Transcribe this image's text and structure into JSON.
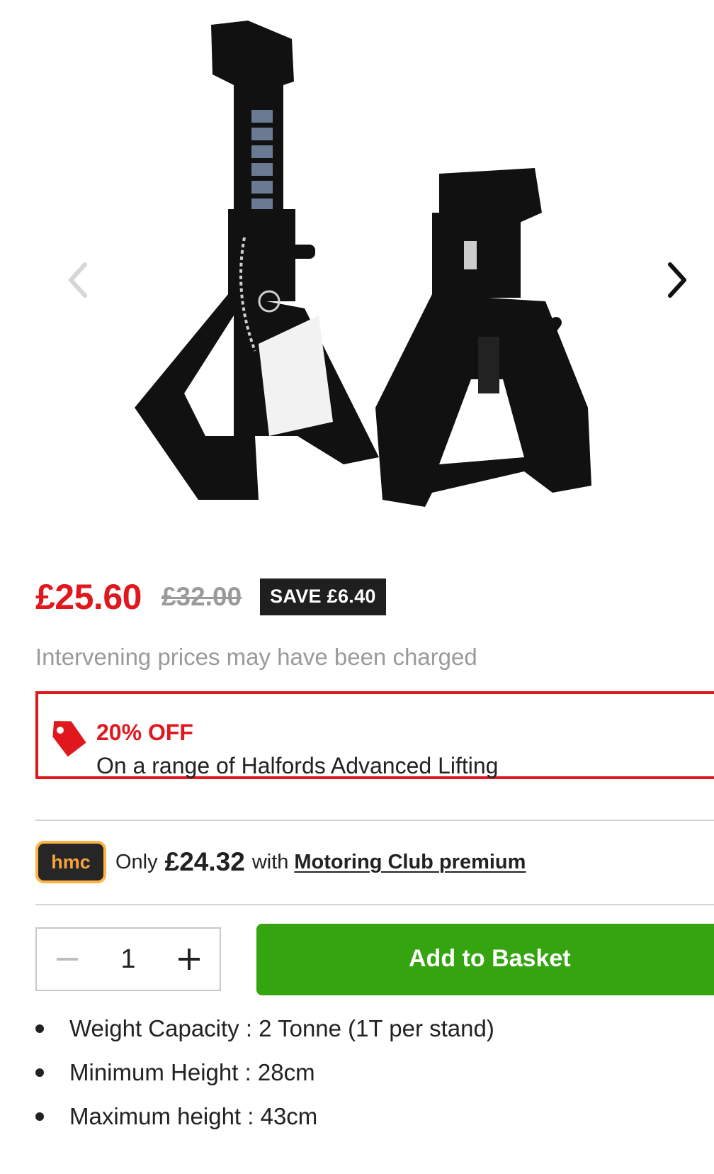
{
  "gallery": {
    "image_alt": "Pair of black axle stands",
    "prev_icon": "chevron-left-icon",
    "next_icon": "chevron-right-icon"
  },
  "price": {
    "current": "£25.60",
    "was": "£32.00",
    "save_badge": "SAVE £6.40",
    "note": "Intervening prices may have been charged"
  },
  "offer": {
    "icon": "price-tag-icon",
    "title": "20% OFF",
    "text": "On a range of Halfords Advanced Lifting"
  },
  "hmc": {
    "badge": "hmc",
    "only": "Only",
    "price": "£24.32",
    "with": "with",
    "link": "Motoring Club premium"
  },
  "quantity": {
    "value": "1",
    "decrease_icon": "minus-icon",
    "increase_icon": "plus-icon"
  },
  "basket": {
    "label": "Add to Basket"
  },
  "specs": [
    "Weight Capacity : 2 Tonne (1T per stand)",
    "Minimum Height : 28cm",
    "Maximum height : 43cm"
  ],
  "colors": {
    "accent_red": "#e0181e",
    "basket_green": "#34a510",
    "save_badge_bg": "#1f1f1f",
    "hmc_orange": "#ffb347",
    "muted_text": "#9a9a9a"
  }
}
